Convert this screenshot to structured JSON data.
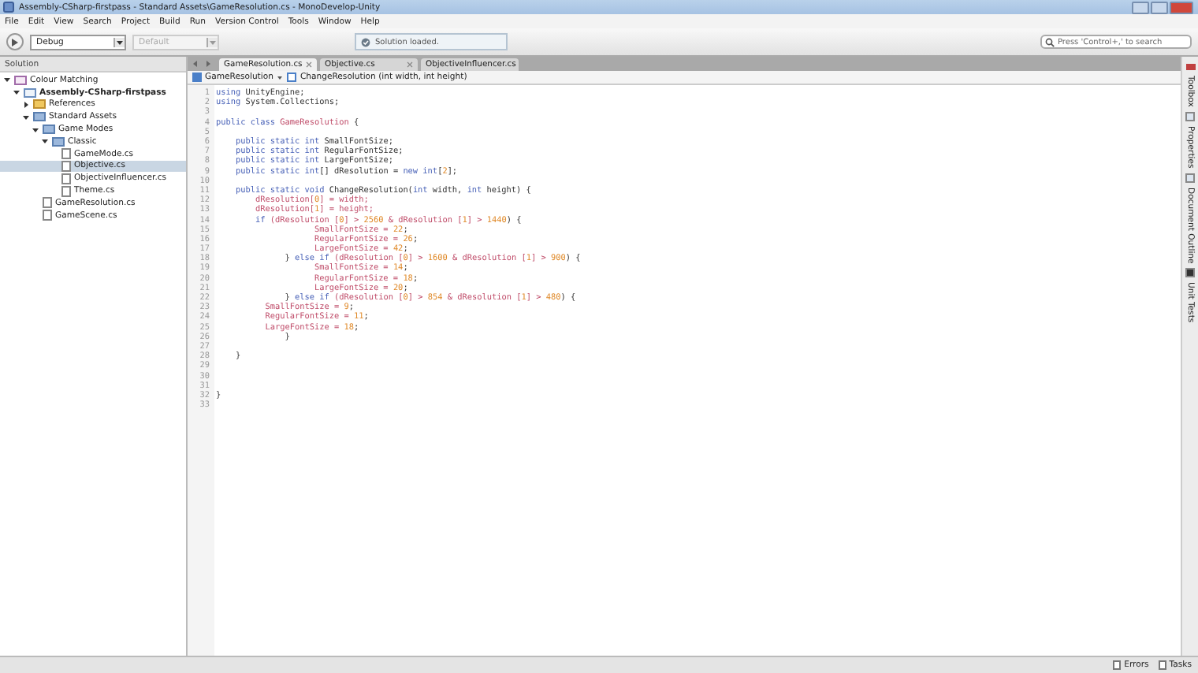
{
  "window": {
    "title": "Assembly-CSharp-firstpass - Standard Assets\\GameResolution.cs - MonoDevelop-Unity"
  },
  "menu": [
    "File",
    "Edit",
    "View",
    "Search",
    "Project",
    "Build",
    "Run",
    "Version Control",
    "Tools",
    "Window",
    "Help"
  ],
  "toolbar": {
    "configuration": "Debug",
    "target": {
      "value": "Default",
      "disabled": true
    },
    "status": "Solution loaded.",
    "search": {
      "placeholder": "Press 'Control+,' to search"
    }
  },
  "solution": {
    "title": "Solution",
    "tree": [
      {
        "label": "Colour Matching",
        "kind": "solution",
        "expanded": true,
        "selected": false,
        "children": [
          {
            "label": "Assembly-CSharp-firstpass",
            "kind": "project",
            "expanded": true,
            "selected": false,
            "children": [
              {
                "label": "References",
                "kind": "references",
                "expanded": false,
                "selected": false
              },
              {
                "label": "Standard Assets",
                "kind": "folder",
                "expanded": true,
                "selected": false,
                "children": [
                  {
                    "label": "Game Modes",
                    "kind": "folder",
                    "expanded": true,
                    "selected": false,
                    "children": [
                      {
                        "label": "Classic",
                        "kind": "folder",
                        "expanded": true,
                        "selected": false,
                        "children": [
                          {
                            "label": "GameMode.cs",
                            "kind": "file",
                            "selected": false
                          },
                          {
                            "label": "Objective.cs",
                            "kind": "file",
                            "selected": true
                          },
                          {
                            "label": "ObjectiveInfluencer.cs",
                            "kind": "file",
                            "selected": false
                          },
                          {
                            "label": "Theme.cs",
                            "kind": "file",
                            "selected": false
                          }
                        ]
                      }
                    ]
                  },
                  {
                    "label": "GameResolution.cs",
                    "kind": "file",
                    "selected": false
                  },
                  {
                    "label": "GameScene.cs",
                    "kind": "file",
                    "selected": false
                  }
                ]
              }
            ]
          }
        ]
      }
    ]
  },
  "editor": {
    "tabs": [
      {
        "label": "GameResolution.cs",
        "selected": true
      },
      {
        "label": "Objective.cs",
        "selected": false
      },
      {
        "label": "ObjectiveInfluencer.cs",
        "selected": false
      }
    ],
    "breadcrumb": [
      "GameResolution",
      "ChangeResolution (int width, int height)"
    ],
    "lines": [
      {
        "number": "1",
        "tokens": [
          {
            "text": "using",
            "kind": "keyword"
          },
          {
            "text": " UnityEngine;",
            "kind": "plain"
          }
        ]
      },
      {
        "number": "2",
        "tokens": [
          {
            "text": "using",
            "kind": "keyword"
          },
          {
            "text": " System.Collections;",
            "kind": "plain"
          }
        ]
      },
      {
        "number": "3"
      },
      {
        "number": "4",
        "tokens": [
          {
            "text": "public class",
            "kind": "keyword"
          },
          {
            "text": " GameResolution",
            "kind": "name"
          },
          {
            "text": " {",
            "kind": "plain"
          }
        ]
      },
      {
        "number": "5"
      },
      {
        "number": "6",
        "tokens": [
          {
            "text": "    public static int",
            "kind": "keyword"
          },
          {
            "text": " SmallFontSize;",
            "kind": "plain"
          }
        ]
      },
      {
        "number": "7",
        "tokens": [
          {
            "text": "    public static int",
            "kind": "keyword"
          },
          {
            "text": " RegularFontSize;",
            "kind": "plain"
          }
        ]
      },
      {
        "number": "8",
        "tokens": [
          {
            "text": "    public static int",
            "kind": "keyword"
          },
          {
            "text": " LargeFontSize;",
            "kind": "plain"
          }
        ]
      },
      {
        "number": "9",
        "tokens": [
          {
            "text": "    public static int",
            "kind": "keyword"
          },
          {
            "text": "[] dResolution = ",
            "kind": "plain"
          },
          {
            "text": "new int",
            "kind": "keyword"
          },
          {
            "text": "[",
            "kind": "plain"
          },
          {
            "text": "2",
            "kind": "number"
          },
          {
            "text": "];",
            "kind": "plain"
          }
        ]
      },
      {
        "number": "10"
      },
      {
        "number": "11",
        "tokens": [
          {
            "text": "    public static void",
            "kind": "keyword"
          },
          {
            "text": " ChangeResolution(",
            "kind": "plain"
          },
          {
            "text": "int",
            "kind": "keyword"
          },
          {
            "text": " width, ",
            "kind": "plain"
          },
          {
            "text": "int",
            "kind": "keyword"
          },
          {
            "text": " height) {",
            "kind": "plain"
          }
        ]
      },
      {
        "number": "12",
        "tokens": [
          {
            "text": "        dResolution[",
            "kind": "field"
          },
          {
            "text": "0",
            "kind": "number"
          },
          {
            "text": "] = width;",
            "kind": "field"
          }
        ]
      },
      {
        "number": "13",
        "tokens": [
          {
            "text": "        dResolution[",
            "kind": "field"
          },
          {
            "text": "1",
            "kind": "number"
          },
          {
            "text": "] = height;",
            "kind": "field"
          }
        ]
      },
      {
        "number": "14",
        "tokens": [
          {
            "text": "        if",
            "kind": "keyword"
          },
          {
            "text": " (dResolution [",
            "kind": "field"
          },
          {
            "text": "0",
            "kind": "number"
          },
          {
            "text": "] > ",
            "kind": "field"
          },
          {
            "text": "2560",
            "kind": "number"
          },
          {
            "text": " & dResolution [",
            "kind": "field"
          },
          {
            "text": "1",
            "kind": "number"
          },
          {
            "text": "] > ",
            "kind": "field"
          },
          {
            "text": "1440",
            "kind": "number"
          },
          {
            "text": ") {",
            "kind": "plain"
          }
        ]
      },
      {
        "number": "15",
        "tokens": [
          {
            "text": "                    SmallFontSize = ",
            "kind": "field"
          },
          {
            "text": "22",
            "kind": "number"
          },
          {
            "text": ";",
            "kind": "plain"
          }
        ]
      },
      {
        "number": "16",
        "tokens": [
          {
            "text": "                    RegularFontSize = ",
            "kind": "field"
          },
          {
            "text": "26",
            "kind": "number"
          },
          {
            "text": ";",
            "kind": "plain"
          }
        ]
      },
      {
        "number": "17",
        "tokens": [
          {
            "text": "                    LargeFontSize = ",
            "kind": "field"
          },
          {
            "text": "42",
            "kind": "number"
          },
          {
            "text": ";",
            "kind": "plain"
          }
        ]
      },
      {
        "number": "18",
        "tokens": [
          {
            "text": "              } ",
            "kind": "plain"
          },
          {
            "text": "else if",
            "kind": "keyword"
          },
          {
            "text": " (dResolution [",
            "kind": "field"
          },
          {
            "text": "0",
            "kind": "number"
          },
          {
            "text": "] > ",
            "kind": "field"
          },
          {
            "text": "1600",
            "kind": "number"
          },
          {
            "text": " & dResolution [",
            "kind": "field"
          },
          {
            "text": "1",
            "kind": "number"
          },
          {
            "text": "] > ",
            "kind": "field"
          },
          {
            "text": "900",
            "kind": "number"
          },
          {
            "text": ") {",
            "kind": "plain"
          }
        ]
      },
      {
        "number": "19",
        "tokens": [
          {
            "text": "                    SmallFontSize = ",
            "kind": "field"
          },
          {
            "text": "14",
            "kind": "number"
          },
          {
            "text": ";",
            "kind": "plain"
          }
        ]
      },
      {
        "number": "20",
        "tokens": [
          {
            "text": "                    RegularFontSize = ",
            "kind": "field"
          },
          {
            "text": "18",
            "kind": "number"
          },
          {
            "text": ";",
            "kind": "plain"
          }
        ]
      },
      {
        "number": "21",
        "tokens": [
          {
            "text": "                    LargeFontSize = ",
            "kind": "field"
          },
          {
            "text": "20",
            "kind": "number"
          },
          {
            "text": ";",
            "kind": "plain"
          }
        ]
      },
      {
        "number": "22",
        "tokens": [
          {
            "text": "              } ",
            "kind": "plain"
          },
          {
            "text": "else if",
            "kind": "keyword"
          },
          {
            "text": " (dResolution [",
            "kind": "field"
          },
          {
            "text": "0",
            "kind": "number"
          },
          {
            "text": "] > ",
            "kind": "field"
          },
          {
            "text": "854",
            "kind": "number"
          },
          {
            "text": " & dResolution [",
            "kind": "field"
          },
          {
            "text": "1",
            "kind": "number"
          },
          {
            "text": "] > ",
            "kind": "field"
          },
          {
            "text": "480",
            "kind": "number"
          },
          {
            "text": ") {",
            "kind": "plain"
          }
        ]
      },
      {
        "number": "23",
        "tokens": [
          {
            "text": "          SmallFontSize = ",
            "kind": "field"
          },
          {
            "text": "9",
            "kind": "number"
          },
          {
            "text": ";",
            "kind": "plain"
          }
        ]
      },
      {
        "number": "24",
        "tokens": [
          {
            "text": "          RegularFontSize = ",
            "kind": "field"
          },
          {
            "text": "11",
            "kind": "number"
          },
          {
            "text": ";",
            "kind": "plain"
          }
        ]
      },
      {
        "number": "25",
        "tokens": [
          {
            "text": "          LargeFontSize = ",
            "kind": "field"
          },
          {
            "text": "18",
            "kind": "number"
          },
          {
            "text": ";",
            "kind": "plain"
          }
        ]
      },
      {
        "number": "26",
        "tokens": [
          {
            "text": "              }",
            "kind": "plain"
          }
        ]
      },
      {
        "number": "27"
      },
      {
        "number": "28",
        "tokens": [
          {
            "text": "    }",
            "kind": "plain"
          }
        ]
      },
      {
        "number": "29"
      },
      {
        "number": "30"
      },
      {
        "number": "31"
      },
      {
        "number": "32",
        "tokens": [
          {
            "text": "}",
            "kind": "plain"
          }
        ]
      },
      {
        "number": "33"
      }
    ]
  },
  "dock": [
    "Toolbox",
    "Properties",
    "Document Outline",
    "Unit Tests"
  ],
  "status_bar": [
    "Errors",
    "Tasks"
  ]
}
